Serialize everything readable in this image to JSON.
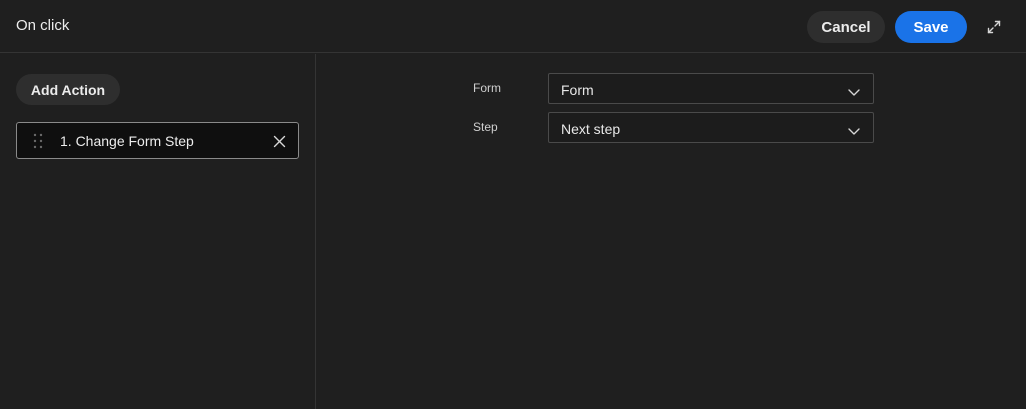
{
  "header": {
    "title": "On click",
    "cancel_label": "Cancel",
    "save_label": "Save",
    "expand_icon": "expand-icon"
  },
  "actions_panel": {
    "add_action_label": "Add Action",
    "items": [
      {
        "label": "1. Change Form Step"
      }
    ]
  },
  "settings": {
    "form": {
      "label": "Form",
      "value": "Form"
    },
    "step": {
      "label": "Step",
      "value": "Next step"
    }
  },
  "colors": {
    "background": "#1f1f1f",
    "accent": "#1a73e8",
    "secondary_button": "#2e2e2e"
  }
}
